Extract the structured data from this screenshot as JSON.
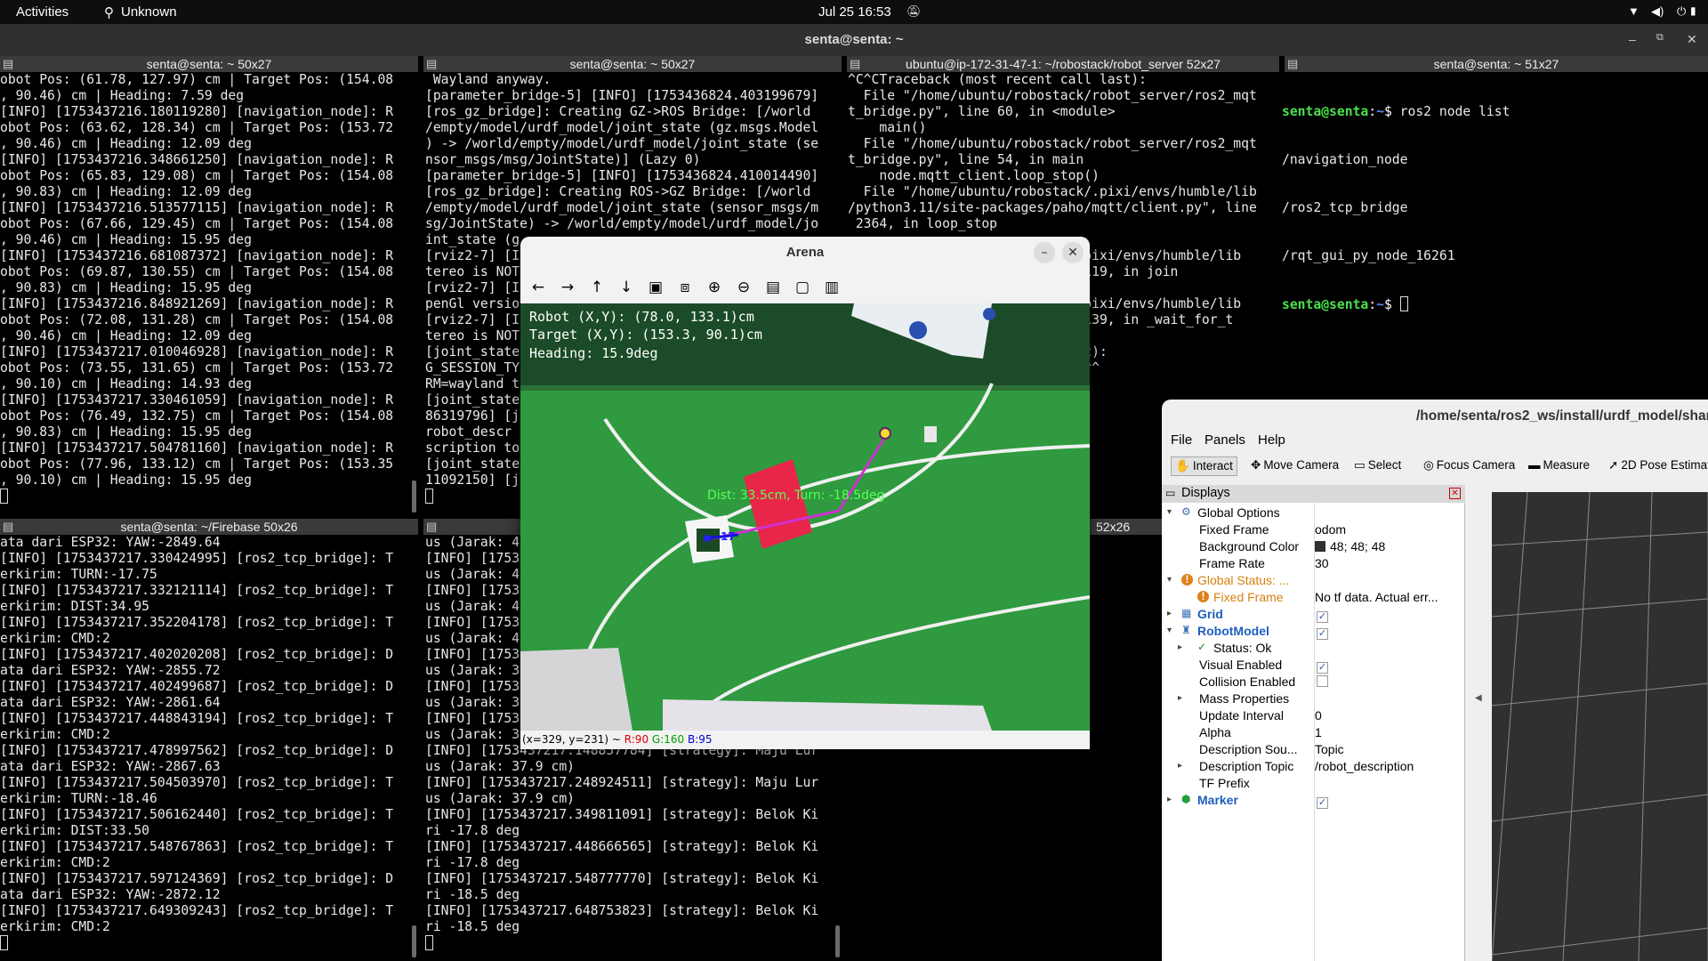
{
  "topbar": {
    "activities": "Activities",
    "app": "Unknown",
    "datetime": "Jul 25  16:53"
  },
  "window_title": "senta@senta: ~",
  "panes": [
    {
      "title": "senta@senta: ~ 50x27",
      "lines": [
        "obot Pos: (61.78, 127.97) cm | Target Pos: (154.08",
        ", 90.46) cm | Heading: 7.59 deg",
        "[INFO] [1753437216.180119280] [navigation_node]: R",
        "obot Pos: (63.62, 128.34) cm | Target Pos: (153.72",
        ", 90.46) cm | Heading: 12.09 deg",
        "[INFO] [1753437216.348661250] [navigation_node]: R",
        "obot Pos: (65.83, 129.08) cm | Target Pos: (154.08",
        ", 90.83) cm | Heading: 12.09 deg",
        "[INFO] [1753437216.513577115] [navigation_node]: R",
        "obot Pos: (67.66, 129.45) cm | Target Pos: (154.08",
        ", 90.46) cm | Heading: 15.95 deg",
        "[INFO] [1753437216.681087372] [navigation_node]: R",
        "obot Pos: (69.87, 130.55) cm | Target Pos: (154.08",
        ", 90.83) cm | Heading: 15.95 deg",
        "[INFO] [1753437216.848921269] [navigation_node]: R",
        "obot Pos: (72.08, 131.28) cm | Target Pos: (154.08",
        ", 90.46) cm | Heading: 12.09 deg",
        "[INFO] [1753437217.010046928] [navigation_node]: R",
        "obot Pos: (73.55, 131.65) cm | Target Pos: (153.72",
        ", 90.10) cm | Heading: 14.93 deg",
        "[INFO] [1753437217.330461059] [navigation_node]: R",
        "obot Pos: (76.49, 132.75) cm | Target Pos: (154.08",
        ", 90.83) cm | Heading: 15.95 deg",
        "[INFO] [1753437217.504781160] [navigation_node]: R",
        "obot Pos: (77.96, 133.12) cm | Target Pos: (153.35",
        ", 90.10) cm | Heading: 15.95 deg"
      ]
    },
    {
      "title": "senta@senta: ~ 50x27",
      "lines": [
        " Wayland anyway.",
        "[parameter_bridge-5] [INFO] [1753436824.403199679]",
        "[ros_gz_bridge]: Creating GZ->ROS Bridge: [/world",
        "/empty/model/urdf_model/joint_state (gz.msgs.Model",
        ") -> /world/empty/model/urdf_model/joint_state (se",
        "nsor_msgs/msg/JointState)] (Lazy 0)",
        "[parameter_bridge-5] [INFO] [1753436824.410014490]",
        "[ros_gz_bridge]: Creating ROS->GZ Bridge: [/world",
        "/empty/model/urdf_model/joint_state (sensor_msgs/m",
        "sg/JointState) -> /world/empty/model/urdf_model/jo",
        "int_state (g",
        "[rviz2-7] [I",
        "tereo is NOT",
        "[rviz2-7] [I",
        "penGl versio",
        "[rviz2-7] [I",
        "tereo is NOT",
        "[joint_state",
        "G_SESSION_TY",
        "RM=wayland t",
        "[joint_state",
        "86319796] [j",
        "robot_descr",
        "scription to",
        "[joint_state",
        "11092150] [j"
      ]
    },
    {
      "title": "ubuntu@ip-172-31-47-1: ~/robostack/robot_server 52x27",
      "lines": [
        "^C^CTraceback (most recent call last):",
        "  File \"/home/ubuntu/robostack/robot_server/ros2_mqt",
        "t_bridge.py\", line 60, in <module>",
        "    main()",
        "  File \"/home/ubuntu/robostack/robot_server/ros2_mqt",
        "t_bridge.py\", line 54, in main",
        "    node.mqtt_client.loop_stop()",
        "  File \"/home/ubuntu/robostack/.pixi/envs/humble/lib",
        "/python3.11/site-packages/paho/mqtt/client.py\", line",
        " 2364, in loop_stop",
        "",
        "                           ./.pixi/envs/humble/lib",
        "                           e 1119, in join",
        "",
        "                           ./.pixi/envs/humble/lib",
        "                           e 1139, in _wait_for_t",
        "",
        "                           eout):",
        "                           ^^^^^"
      ]
    },
    {
      "title": "senta@senta: ~ 51x27",
      "prompt": "senta@senta",
      "cmd": "ros2 node list",
      "nodes": [
        "/navigation_node",
        "/ros2_tcp_bridge",
        "/rqt_gui_py_node_16261"
      ]
    },
    {
      "title": "senta@senta: ~/Firebase 50x26",
      "lines": [
        "ata dari ESP32: YAW:-2849.64",
        "[INFO] [1753437217.330424995] [ros2_tcp_bridge]: T",
        "erkirim: TURN:-17.75",
        "[INFO] [1753437217.332121114] [ros2_tcp_bridge]: T",
        "erkirim: DIST:34.95",
        "[INFO] [1753437217.352204178] [ros2_tcp_bridge]: T",
        "erkirim: CMD:2",
        "[INFO] [1753437217.402020208] [ros2_tcp_bridge]: D",
        "ata dari ESP32: YAW:-2855.72",
        "[INFO] [1753437217.402499687] [ros2_tcp_bridge]: D",
        "ata dari ESP32: YAW:-2861.64",
        "[INFO] [1753437217.448843194] [ros2_tcp_bridge]: T",
        "erkirim: CMD:2",
        "[INFO] [1753437217.478997562] [ros2_tcp_bridge]: D",
        "ata dari ESP32: YAW:-2867.63",
        "[INFO] [1753437217.504503970] [ros2_tcp_bridge]: T",
        "erkirim: TURN:-18.46",
        "[INFO] [1753437217.506162440] [ros2_tcp_bridge]: T",
        "erkirim: DIST:33.50",
        "[INFO] [1753437217.548767863] [ros2_tcp_bridge]: T",
        "erkirim: CMD:2",
        "[INFO] [1753437217.597124369] [ros2_tcp_bridge]: D",
        "ata dari ESP32: YAW:-2872.12",
        "[INFO] [1753437217.649309243] [ros2_tcp_bridge]: T",
        "erkirim: CMD:2"
      ]
    },
    {
      "title": "",
      "lines": [
        "us (Jarak: 4",
        "[INFO] [1753",
        "us (Jarak: 4",
        "[INFO] [1753",
        "us (Jarak: 4",
        "[INFO] [1753",
        "us (Jarak: 4",
        "[INFO] [1753",
        "us (Jarak: 3",
        "[INFO] [1753",
        "us (Jarak: 3",
        "[INFO] [1753",
        "us (Jarak: 3",
        "[INFO] [1753437217.148857784] [strategy]: Maju Lur",
        "us (Jarak: 37.9 cm)",
        "[INFO] [1753437217.248924511] [strategy]: Maju Lur",
        "us (Jarak: 37.9 cm)",
        "[INFO] [1753437217.349811091] [strategy]: Belok Ki",
        "ri -17.8 deg",
        "[INFO] [1753437217.448666565] [strategy]: Belok Ki",
        "ri -17.8 deg",
        "[INFO] [1753437217.548777770] [strategy]: Belok Ki",
        "ri -18.5 deg",
        "[INFO] [1753437217.648753823] [strategy]: Belok Ki",
        "ri -18.5 deg"
      ]
    },
    {
      "title": "52x26",
      "lines": []
    }
  ],
  "pane2_green": [
    "172-31-47-",
    "172-31-47-",
    "172-31-47-"
  ],
  "arena": {
    "title": "Arena",
    "toolbar": [
      "arrow-left-icon",
      "arrow-right-icon",
      "arrow-up-icon",
      "arrow-down-icon",
      "zoom-fit-icon",
      "zoom-region-icon",
      "zoom-in-icon",
      "zoom-out-icon",
      "save-icon",
      "copy-icon",
      "properties-icon"
    ],
    "overlay": [
      "Robot (X,Y): (78.0, 133.1)cm",
      "Target (X,Y): (153.3, 90.1)cm",
      "Heading: 15.9deg"
    ],
    "dist_label": "Dist: 33.5cm, Turn: -18.5deg",
    "robot_id": "17",
    "status": {
      "coords": "(x=329, y=231) ~ ",
      "r": "R:90",
      "g": "G:160",
      "b": "B:95"
    }
  },
  "rviz": {
    "title": "/home/senta/ros2_ws/install/urdf_model/share/urdf_model/rviz/config.rviz* - RViz",
    "menus": [
      "File",
      "Panels",
      "Help"
    ],
    "tools": [
      {
        "icon": "hand-icon",
        "label": "Interact"
      },
      {
        "icon": "move-camera-icon",
        "label": "Move Camera"
      },
      {
        "icon": "select-icon",
        "label": "Select"
      },
      {
        "icon": "focus-camera-icon",
        "label": "Focus Camera"
      },
      {
        "icon": "measure-icon",
        "label": "Measure"
      },
      {
        "icon": "pose-arrow-icon",
        "label": "2D Pose Estimate"
      }
    ],
    "displays_title": "Displays",
    "rows": [
      {
        "k": "Global Options",
        "v": "",
        "lvl": 0,
        "exp": "▾",
        "icon": "gear"
      },
      {
        "k": "Fixed Frame",
        "v": "odom",
        "lvl": 1
      },
      {
        "k": "Background Color",
        "v": "48; 48; 48",
        "lvl": 1,
        "swatch": "#303030"
      },
      {
        "k": "Frame Rate",
        "v": "30",
        "lvl": 1
      },
      {
        "k": "Global Status: ...",
        "v": "",
        "lvl": 0,
        "exp": "▾",
        "icon": "warn",
        "cls": "warn"
      },
      {
        "k": "Fixed Frame",
        "v": "No tf data.  Actual err...",
        "lvl": 1,
        "icon": "warn",
        "cls": "warn"
      },
      {
        "k": "Grid",
        "v": "✓",
        "lvl": 0,
        "exp": "▸",
        "icon": "grid",
        "cls": "blue",
        "check": true
      },
      {
        "k": "RobotModel",
        "v": "✓",
        "lvl": 0,
        "exp": "▾",
        "icon": "robot",
        "cls": "blue",
        "check": true
      },
      {
        "k": "Status: Ok",
        "v": "",
        "lvl": 1,
        "exp": "▸",
        "icon": "ok"
      },
      {
        "k": "Visual Enabled",
        "v": "✓",
        "lvl": 1,
        "check": true
      },
      {
        "k": "Collision Enabled",
        "v": "",
        "lvl": 1,
        "check": true
      },
      {
        "k": "Mass Properties",
        "v": "",
        "lvl": 1,
        "exp": "▸"
      },
      {
        "k": "Update Interval",
        "v": "0",
        "lvl": 1
      },
      {
        "k": "Alpha",
        "v": "1",
        "lvl": 1
      },
      {
        "k": "Description Sou...",
        "v": "Topic",
        "lvl": 1
      },
      {
        "k": "Description Topic",
        "v": "/robot_description",
        "lvl": 1,
        "exp": "▸"
      },
      {
        "k": "TF Prefix",
        "v": "",
        "lvl": 1
      },
      {
        "k": "Marker",
        "v": "✓",
        "lvl": 0,
        "exp": "▸",
        "icon": "marker",
        "cls": "blue",
        "check": true
      }
    ]
  }
}
